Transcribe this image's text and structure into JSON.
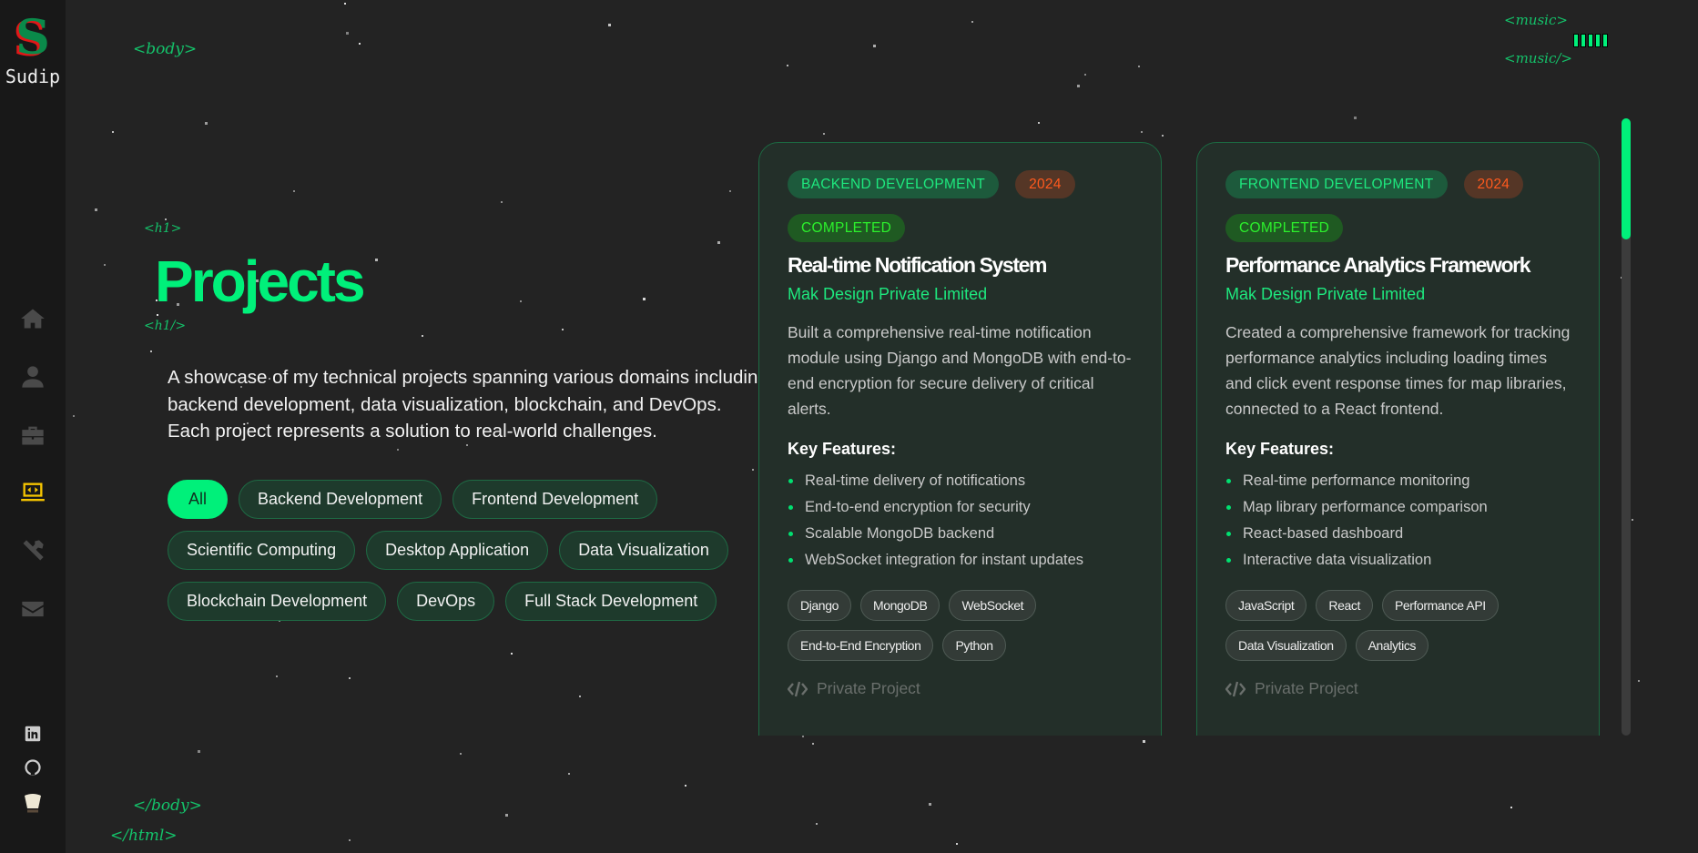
{
  "brand": {
    "logo_letter": "S",
    "name": "Sudip"
  },
  "decor": {
    "body_open": "<body>",
    "body_close": "</body>",
    "html_close": "</html>",
    "h1_open": "<h1>",
    "h1_close": "<h1/>",
    "music_open": "<music>",
    "music_close": "<music/>"
  },
  "nav": [
    "home",
    "about",
    "experience",
    "projects",
    "skills",
    "contact"
  ],
  "social": [
    "linkedin",
    "github",
    "chef"
  ],
  "page": {
    "title": "Projects",
    "description": "A showcase of my technical projects spanning various domains including backend development, data visualization, blockchain, and DevOps. Each project represents a solution to real-world challenges."
  },
  "filters": [
    "All",
    "Backend Development",
    "Frontend Development",
    "Scientific Computing",
    "Desktop Application",
    "Data Visualization",
    "Blockchain Development",
    "DevOps",
    "Full Stack Development"
  ],
  "active_filter": "All",
  "scroll_position": 0,
  "cards": [
    {
      "category": "BACKEND DEVELOPMENT",
      "year": "2024",
      "status": "COMPLETED",
      "title": "Real-time Notification System",
      "company": "Mak Design Private Limited",
      "description": "Built a comprehensive real-time notification module using Django and MongoDB with end-to-end encryption for secure delivery of critical alerts.",
      "features_label": "Key Features:",
      "features": [
        "Real-time delivery of notifications",
        "End-to-end encryption for security",
        "Scalable MongoDB backend",
        "WebSocket integration for instant updates"
      ],
      "tech": [
        "Django",
        "MongoDB",
        "WebSocket",
        "End-to-End Encryption",
        "Python"
      ],
      "link": "Private Project"
    },
    {
      "category": "FRONTEND DEVELOPMENT",
      "year": "2024",
      "status": "COMPLETED",
      "title": "Performance Analytics Framework",
      "company": "Mak Design Private Limited",
      "description": "Created a comprehensive framework for tracking performance analytics including loading times and click event response times for map libraries, connected to a React frontend.",
      "features_label": "Key Features:",
      "features": [
        "Real-time performance monitoring",
        "Map library performance comparison",
        "React-based dashboard",
        "Interactive data visualization"
      ],
      "tech": [
        "JavaScript",
        "React",
        "Performance API",
        "Data Visualization",
        "Analytics"
      ],
      "link": "Private Project"
    }
  ],
  "colors": {
    "accent": "#00f07a",
    "sidebar": "#181818",
    "bg": "#232323",
    "active_nav": "#f5c400"
  }
}
